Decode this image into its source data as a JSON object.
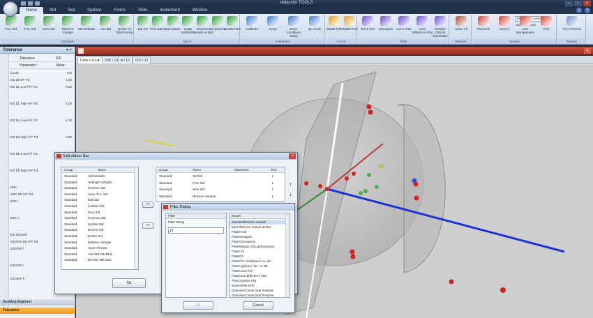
{
  "app": {
    "title": "datacolor TOOLS",
    "menu_tabs": [
      "Home",
      "Std",
      "Bat",
      "System",
      "Forms",
      "Plots",
      "Instrument",
      "Window"
    ]
  },
  "ribbon": {
    "groups": [
      {
        "label": "Standard",
        "buttons": [
          "First Std",
          "Prev Std",
          "Next Std",
          "Retrieve Sample",
          "Std Defaults",
          "List Std",
          "Delete All Tabs/Format"
        ]
      },
      {
        "label": "Batch",
        "buttons": [
          "Bat Init",
          "Prev Batch",
          "Next Batch",
          "Swap Std/Batch",
          "Retrieve Sample as Bat",
          "Bat Defaults",
          "List/Del Bat"
        ]
      },
      {
        "label": "Instrument",
        "buttons": [
          "Calibrate",
          "Setup",
          "Meas. Conditions Setup",
          "QC Code"
        ]
      },
      {
        "label": "Forms",
        "buttons": [
          "MSBB PdF",
          "MSBB Print"
        ]
      },
      {
        "label": "Plots",
        "buttons": [
          "Trend Plot",
          "Histogram",
          "Curve Plot",
          "Color Difference Plot",
          "Multiple CIELab Illuminants"
        ]
      },
      {
        "label": "Window",
        "buttons": [
          "Close All"
        ]
      },
      {
        "label": "System",
        "buttons": [
          "Plot Defs",
          "Search",
          "User Management",
          "Print"
        ]
      },
      {
        "label": "Options",
        "buttons": [
          "Print Preview"
        ]
      }
    ],
    "illuminant_select": "D65 CMC Combi",
    "edit_tolerance_label": "Edit Tolerance"
  },
  "left_panel": {
    "title": "Tolerance",
    "pin": "▾ ×",
    "header1": [
      "Tolerance",
      "P/F"
    ],
    "header2": [
      "Parameter",
      "Value"
    ],
    "rows": [
      {
        "name": "CxLab",
        "value": "Fail"
      },
      {
        "name": "CIE Dl R/F Tol.",
        "value": "1.00"
      },
      {
        "name": "CIE DL Low P/F Tol.",
        "value": "-0.50"
      },
      {
        "name": "CIE DL High P/F Tol.",
        "value": "1.00"
      },
      {
        "name": "CIE Da Low P/F Tol.",
        "value": "-1.10"
      },
      {
        "name": "CIE Da High P/F Tol.",
        "value": "0.90"
      },
      {
        "name": "CIE Db Low P/F Tol.",
        "value": "1.00"
      },
      {
        "name": "CIE Db High P/F Tol.",
        "value": ""
      },
      {
        "name": "CMC",
        "value": "Pass"
      },
      {
        "name": "CMC DE P/F Tol.",
        "value": "1.00"
      },
      {
        "name": "CMC l",
        "value": "2.00"
      },
      {
        "name": "CMC c",
        "value": "1.00"
      },
      {
        "name": "CIE DE2000",
        "value": "Pass"
      },
      {
        "name": "CIE2000 DE P/F Tol.",
        "value": "1.00"
      },
      {
        "name": "CIE2000 l",
        "value": "1.00"
      },
      {
        "name": "CIE2000 c",
        "value": "1.00"
      },
      {
        "name": "CIE2000 h",
        "value": "1.00"
      }
    ],
    "bottom_tabs": [
      "Desktop Explorer",
      "Tolerance"
    ]
  },
  "main": {
    "doc_tabs": [
      "Delta CieLab",
      "D65 / 10",
      "A / 10",
      "F02 / 10"
    ]
  },
  "edit_ribbon_dialog": {
    "title": "Edit ribbon Bar",
    "left_headers": [
      "Group",
      "Name"
    ],
    "left_rows": [
      [
        "Standard",
        "Std Defaults"
      ],
      [
        "Standard",
        "Strength Defaults"
      ],
      [
        "Standard",
        "Retrieve Std"
      ],
      [
        "Standard",
        "Store Cur. Std"
      ],
      [
        "Standard",
        "Edit Std"
      ],
      [
        "Standard",
        "List/Del Std"
      ],
      [
        "Standard",
        "Next Std"
      ],
      [
        "Standard",
        "Previous Std"
      ],
      [
        "Standard",
        "Update Std"
      ],
      [
        "Standard",
        "Recent Std"
      ],
      [
        "Standard",
        "Delete Std"
      ],
      [
        "Standard",
        "Retrieve Sample"
      ],
      [
        "Standard",
        "Store All Stds"
      ],
      [
        "Standard",
        "Add Std Tab Defs"
      ],
      [
        "Standard",
        "Del Std Tab Defs"
      ]
    ],
    "right_headers": [
      "Group",
      "Name",
      "Parameter",
      "Size"
    ],
    "right_rows": [
      [
        "Standard",
        "Std Init",
        "",
        "L"
      ],
      [
        "Standard",
        "Prev Std",
        "",
        "L"
      ],
      [
        "Standard",
        "Next Std",
        "",
        "L"
      ],
      [
        "Standard",
        "Retrieve Sample",
        "",
        "L"
      ]
    ],
    "add_button": ">>",
    "remove_button": "<<",
    "ok_button": "Ok"
  },
  "filter_dialog": {
    "title": "Filter Dialog",
    "left_header": "Filter",
    "filter_label": "Filter String",
    "filter_value": "pl",
    "result_header": "Result",
    "results": [
      "Standard/Retrieve Sample",
      "Batch/Retrieve Sample as Bat",
      "Plots/Trend",
      "Plots/Histogram",
      "Plots/Chromaticity",
      "Plots/Multiple CIELab Illuminants",
      "Plots/LCh",
      "Plots/K/S",
      "Plots/K/S / Absorbance vs. WL",
      "Plots/Log(K/S) / Abs. vs. WL",
      "Plots/Curve Plot",
      "Plots/Color Difference Plot",
      "Plots/Absolute Plot",
      "System/Plot Defs",
      "Operation/Create Data Template",
      "Operation/Create Data Template"
    ],
    "ok_button": "Ok",
    "cancel_button": "Cancel"
  },
  "colors": {
    "accent": "#c0392b",
    "ribbon": "#d4e0f0",
    "titlebar": "#22334e",
    "viewport": "#cfcfcf"
  }
}
